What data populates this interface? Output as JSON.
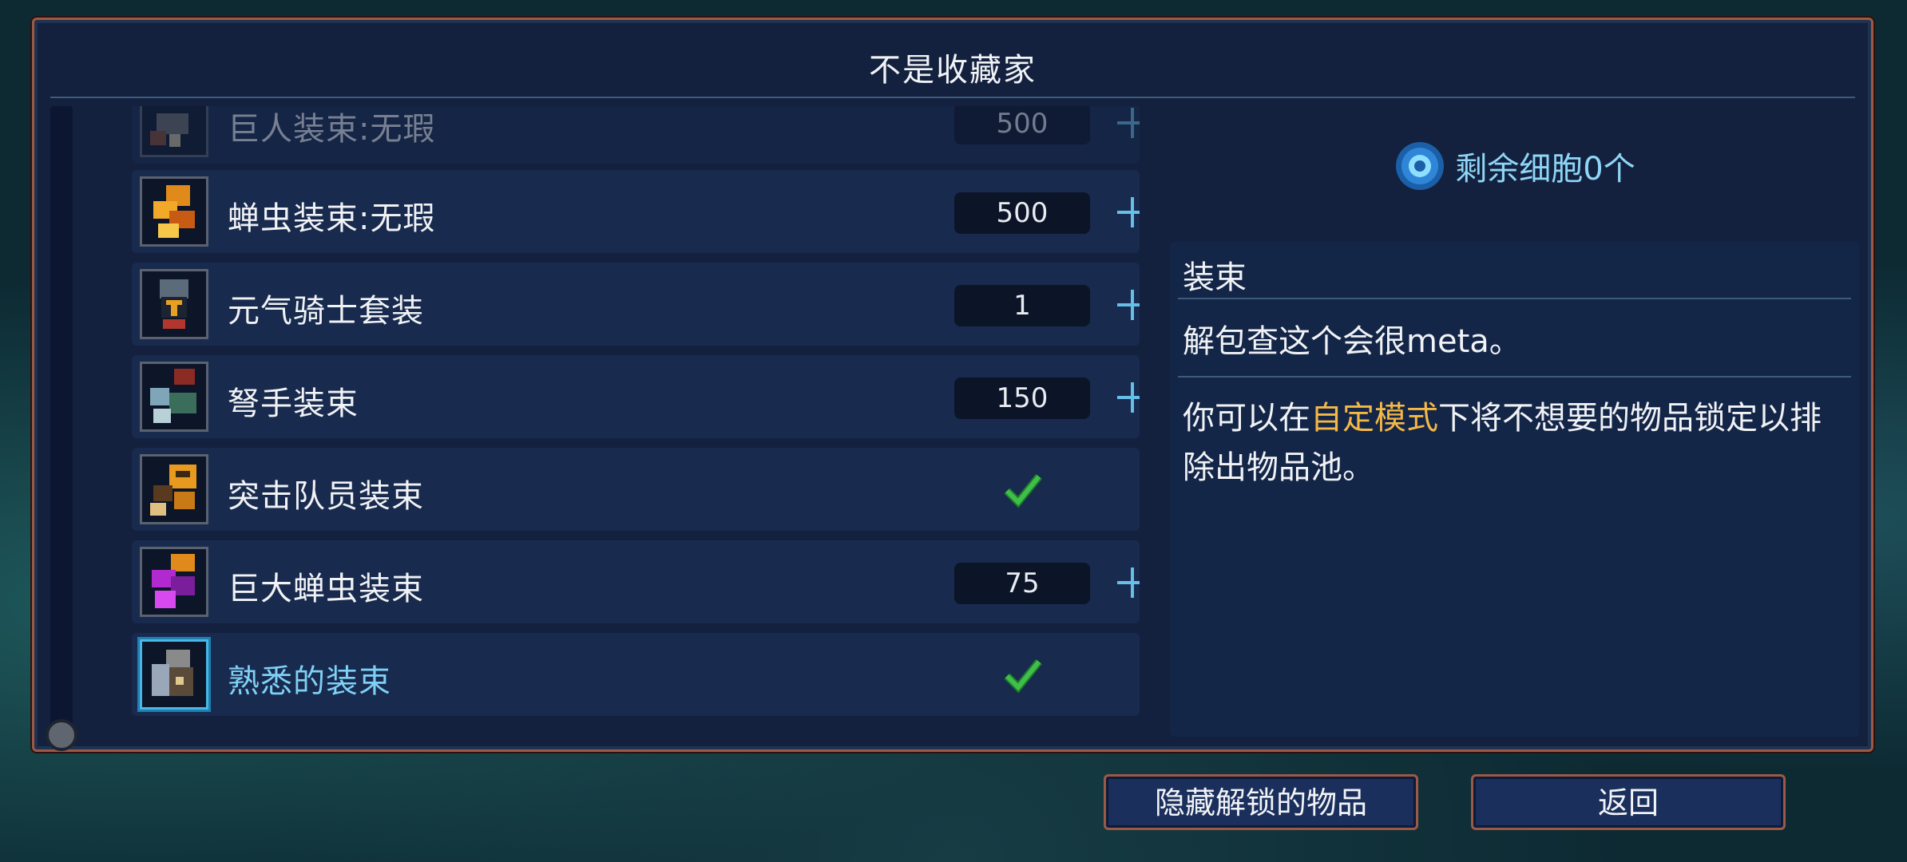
{
  "dialog": {
    "title": "不是收藏家"
  },
  "items": [
    {
      "name": "巨人装束:无瑕",
      "cost": "500",
      "state": "buy"
    },
    {
      "name": "蝉虫装束:无瑕",
      "cost": "500",
      "state": "buy"
    },
    {
      "name": "元气骑士套装",
      "cost": "1",
      "state": "buy"
    },
    {
      "name": "弩手装束",
      "cost": "150",
      "state": "buy"
    },
    {
      "name": "突击队员装束",
      "cost": "",
      "state": "owned"
    },
    {
      "name": "巨大蝉虫装束",
      "cost": "75",
      "state": "buy"
    },
    {
      "name": "熟悉的装束",
      "cost": "",
      "state": "owned"
    }
  ],
  "cells": {
    "label": "剩余细胞0个"
  },
  "detail": {
    "title": "装束",
    "subtitle": "解包查这个会很meta。",
    "hint_before": "你可以在",
    "hint_highlight": "自定模式",
    "hint_after": "下将不想要的物品锁定以排除出物品池。"
  },
  "buttons": {
    "hide": "隐藏解锁的物品",
    "back": "返回"
  },
  "colors": {
    "accent": "#66bfe8",
    "highlight": "#f4b845",
    "check": "#3fbf4a",
    "frame": "#9c5a46"
  }
}
